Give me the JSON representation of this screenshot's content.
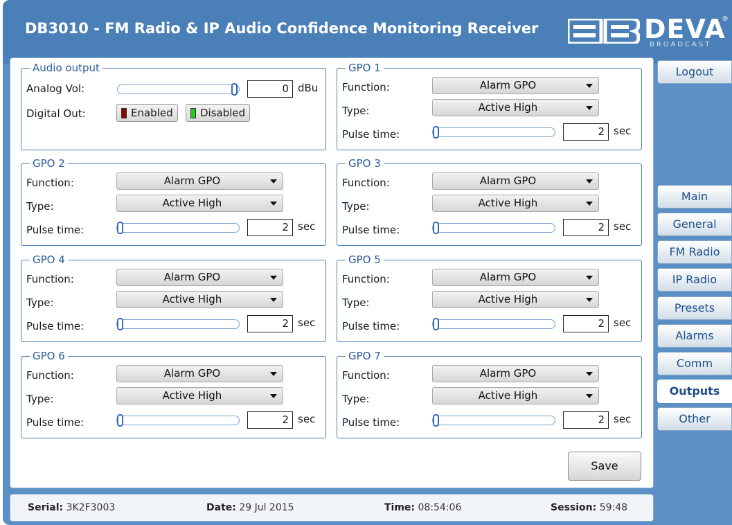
{
  "header": {
    "title": "DB3010 - FM Radio & IP Audio Confidence Monitoring Receiver",
    "logo_text": "DEVA",
    "logo_reg": "®",
    "logo_sub": "BROADCAST"
  },
  "audio_output": {
    "legend": "Audio output",
    "analog_label": "Analog Vol:",
    "analog_value": "0",
    "analog_unit": "dBu",
    "analog_level": 1.0,
    "digital_label": "Digital Out:",
    "enabled_label": "Enabled",
    "disabled_label": "Disabled",
    "colors": {
      "enabled_led": "#8b0000",
      "disabled_led": "#22cc22"
    }
  },
  "gpo_labels": {
    "function": "Function:",
    "type": "Type:",
    "pulse": "Pulse time:",
    "unit": "sec"
  },
  "gpos": [
    {
      "legend": "GPO 1",
      "function": "Alarm GPO",
      "type": "Active High",
      "pulse": "2",
      "pulse_level": 0.0
    },
    {
      "legend": "GPO 2",
      "function": "Alarm GPO",
      "type": "Active High",
      "pulse": "2",
      "pulse_level": 0.0
    },
    {
      "legend": "GPO 3",
      "function": "Alarm GPO",
      "type": "Active High",
      "pulse": "2",
      "pulse_level": 0.0
    },
    {
      "legend": "GPO 4",
      "function": "Alarm GPO",
      "type": "Active High",
      "pulse": "2",
      "pulse_level": 0.0
    },
    {
      "legend": "GPO 5",
      "function": "Alarm GPO",
      "type": "Active High",
      "pulse": "2",
      "pulse_level": 0.0
    },
    {
      "legend": "GPO 6",
      "function": "Alarm GPO",
      "type": "Active High",
      "pulse": "2",
      "pulse_level": 0.0
    },
    {
      "legend": "GPO 7",
      "function": "Alarm GPO",
      "type": "Active High",
      "pulse": "2",
      "pulse_level": 0.0
    }
  ],
  "save_label": "Save",
  "sidebar": {
    "logout": "Logout",
    "items": [
      "Main",
      "General",
      "FM Radio",
      "IP Radio",
      "Presets",
      "Alarms",
      "Comm",
      "Outputs",
      "Other"
    ],
    "active": "Outputs"
  },
  "status": {
    "serial_label": "Serial:",
    "serial": "3K2F3003",
    "date_label": "Date:",
    "date": "29 Jul 2015",
    "time_label": "Time:",
    "time": "08:54:06",
    "session_label": "Session:",
    "session": "59:48"
  },
  "colors": {
    "header": "#4a7fb8",
    "frame": "#5b90c6",
    "accent": "#1d4f8a"
  }
}
